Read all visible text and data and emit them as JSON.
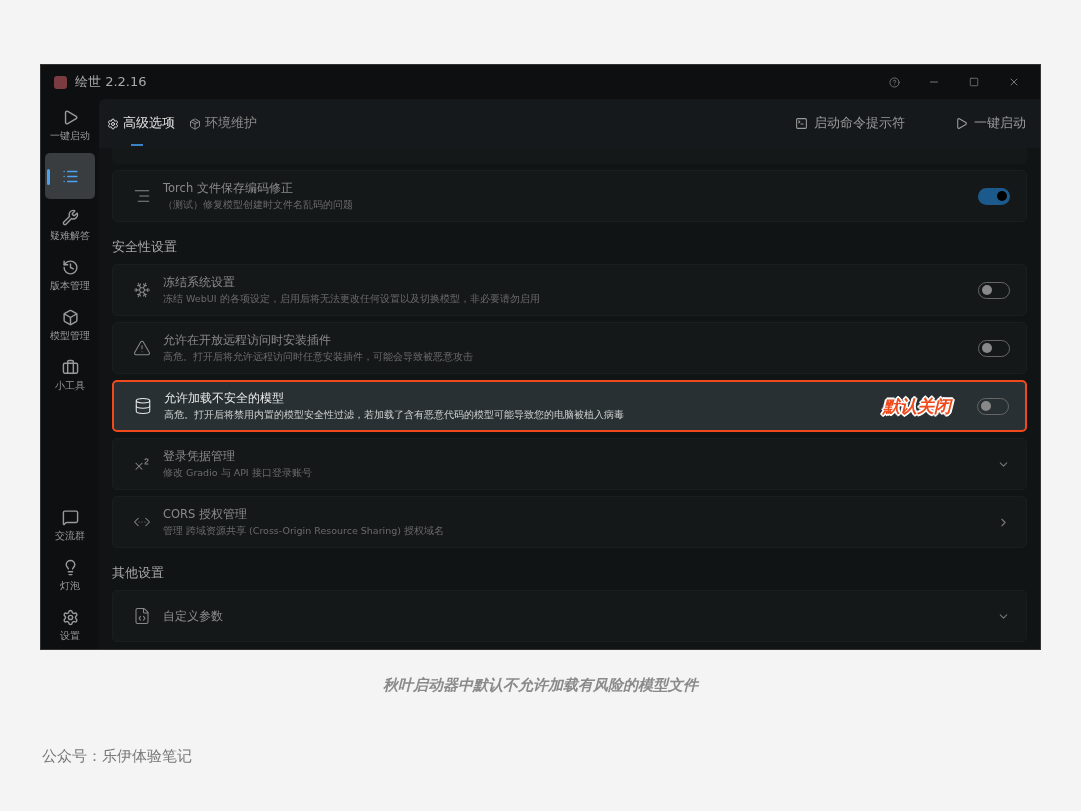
{
  "window": {
    "title": "绘世 2.2.16"
  },
  "sidebar": {
    "items": [
      {
        "label": "一键启动",
        "selected": false
      },
      {
        "selected": true
      },
      {
        "label": "疑难解答",
        "selected": false
      },
      {
        "label": "版本管理",
        "selected": false
      },
      {
        "label": "模型管理",
        "selected": false
      },
      {
        "label": "小工具",
        "selected": false
      }
    ],
    "bottom_items": [
      {
        "label": "交流群",
        "selected": false
      },
      {
        "label": "灯泡",
        "selected": false
      },
      {
        "label": "设置",
        "selected": false
      }
    ]
  },
  "header": {
    "tabs": [
      {
        "label": "高级选项",
        "selected": true
      },
      {
        "label": "环境维护",
        "selected": false
      }
    ],
    "actions": [
      {
        "label": "启动命令提示符"
      },
      {
        "label": "一键启动"
      }
    ]
  },
  "sections": [
    {
      "rows": [
        {
          "kind": "partial"
        },
        {
          "kind": "toggle",
          "title": "Torch 文件保存编码修正",
          "description": "（测试）修复模型创建时文件名乱码的问题",
          "on": true,
          "highlighted": false
        }
      ]
    },
    {
      "heading": "安全性设置",
      "rows": [
        {
          "kind": "toggle",
          "title": "冻结系统设置",
          "description": "冻结 WebUI 的各项设定，启用后将无法更改任何设置以及切换模型，非必要请勿启用",
          "on": false,
          "highlighted": false
        },
        {
          "kind": "toggle",
          "title": "允许在开放远程访问时安装插件",
          "description": "高危。打开后将允许远程访问时任意安装插件，可能会导致被恶意攻击",
          "on": false,
          "highlighted": false
        },
        {
          "kind": "toggle",
          "title": "允许加载不安全的模型",
          "description": "高危。打开后将禁用内置的模型安全性过滤，若加载了含有恶意代码的模型可能导致您的电脑被植入病毒",
          "on": false,
          "highlighted": true,
          "annotation": "默认关闭"
        },
        {
          "kind": "expand",
          "title": "登录凭据管理",
          "description": "修改 Gradio 与 API 接口登录账号"
        },
        {
          "kind": "link",
          "title": "CORS 授权管理",
          "description": "管理 跨域资源共享 (Cross-Origin Resource Sharing) 授权域名"
        }
      ]
    },
    {
      "heading": "其他设置",
      "rows": [
        {
          "kind": "expand",
          "title": "自定义参数"
        }
      ]
    }
  ],
  "caption": "秋叶启动器中默认不允许加载有风险的模型文件",
  "author": "公众号：乐伊体验笔记"
}
